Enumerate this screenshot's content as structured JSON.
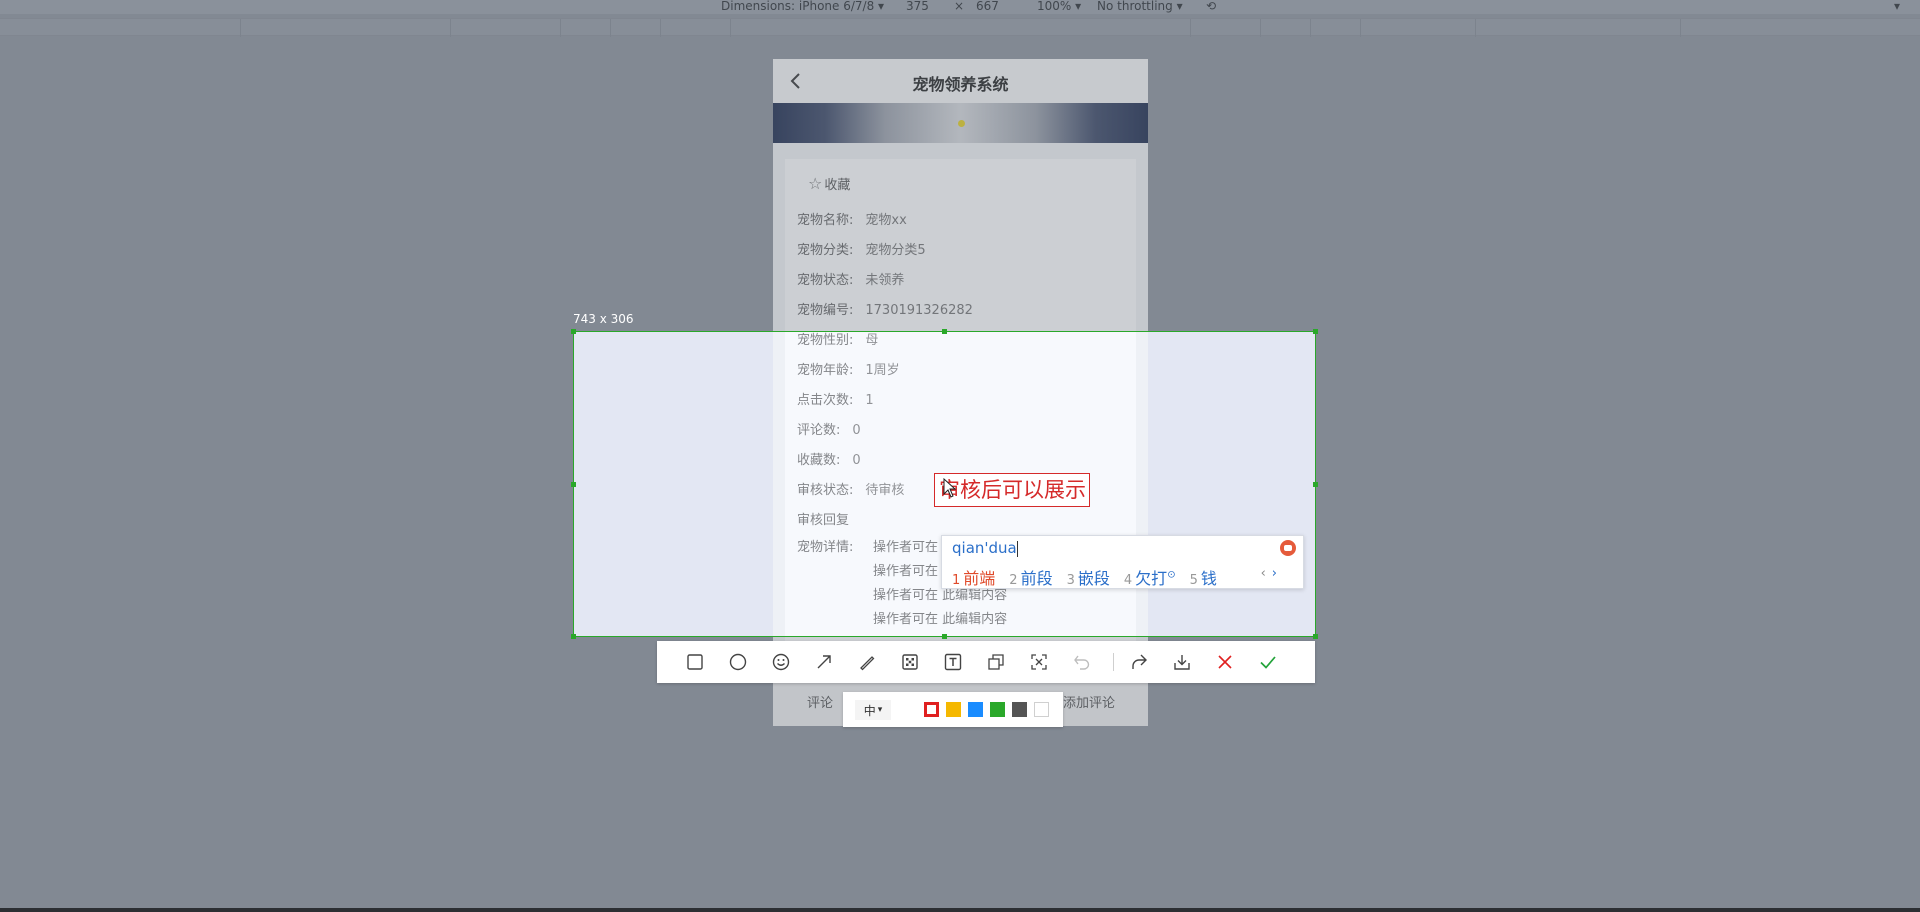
{
  "devtools": {
    "dimensions": "Dimensions: iPhone 6/7/8",
    "width": "375",
    "times": "×",
    "height": "667",
    "zoom": "100%",
    "throttling": "No throttling"
  },
  "phone": {
    "title": "宠物领养系统",
    "favorite_label": "收藏",
    "fields": [
      {
        "label": "宠物名称:",
        "value": "宠物xx"
      },
      {
        "label": "宠物分类:",
        "value": "宠物分类5"
      },
      {
        "label": "宠物状态:",
        "value": "未领养"
      },
      {
        "label": "宠物编号:",
        "value": "1730191326282"
      },
      {
        "label": "宠物性别:",
        "value": "母"
      },
      {
        "label": "宠物年龄:",
        "value": "1周岁"
      },
      {
        "label": "点击次数:",
        "value": "1"
      },
      {
        "label": "评论数:",
        "value": "0"
      },
      {
        "label": "收藏数:",
        "value": "0"
      },
      {
        "label": "审核状态:",
        "value": "待审核"
      }
    ],
    "review_reply_label": "审核回复",
    "detail_label": "宠物详情:",
    "detail_lines": [
      "操作者可在",
      "操作者可在",
      "操作者可在 此编辑内容",
      "操作者可在 此编辑内容"
    ],
    "footer": {
      "comment": "评论",
      "add_comment": "添加评论"
    }
  },
  "capture": {
    "selection_size": "743 x 306",
    "text_annotation": "审核后可以展示",
    "ime": {
      "input": "qian'dua",
      "candidates": [
        {
          "num": "1",
          "word": "前端"
        },
        {
          "num": "2",
          "word": "前段"
        },
        {
          "num": "3",
          "word": "嵌段"
        },
        {
          "num": "4",
          "word": "欠打"
        },
        {
          "num": "5",
          "word": "钱"
        }
      ],
      "prev": "‹",
      "next": "›"
    },
    "tools": [
      "rectangle-icon",
      "ellipse-icon",
      "emoji-icon",
      "arrow-icon",
      "pen-icon",
      "mosaic-icon",
      "text-icon",
      "pin-icon",
      "ocr-icon",
      "undo-icon",
      "share-icon",
      "download-icon",
      "cancel-icon",
      "confirm-icon"
    ],
    "font_size_option": "中",
    "colors": [
      "#e02020",
      "#f5b800",
      "#1a8cff",
      "#2aa82a",
      "#555555",
      "#ffffff"
    ],
    "selected_color": "#e02020"
  }
}
